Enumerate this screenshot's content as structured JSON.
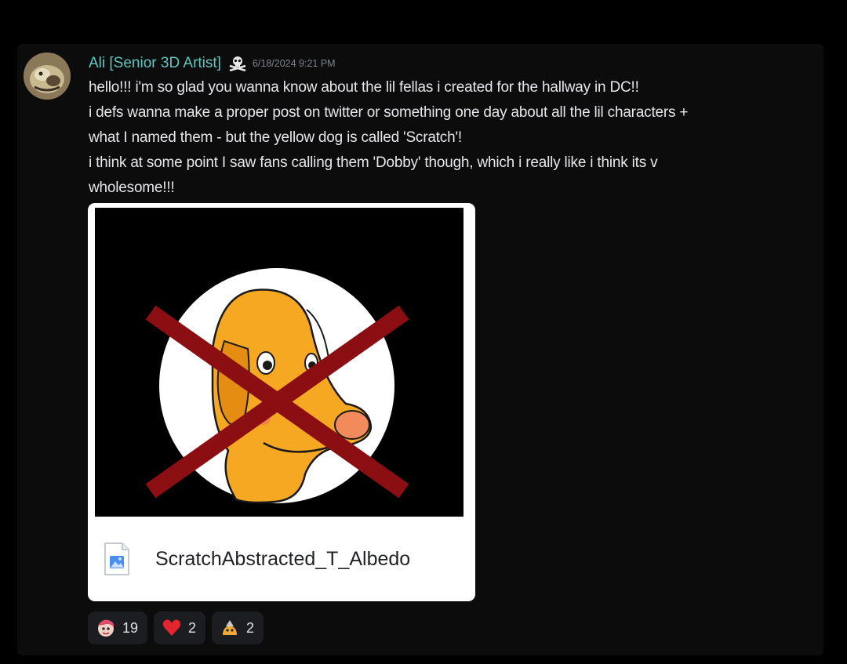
{
  "message": {
    "author": "Ali [Senior 3D Artist]",
    "role_icon": "skull-crossbones-icon",
    "timestamp": "6/18/2024 9:21 PM",
    "lines": [
      "hello!!! i'm so glad you wanna know about the lil fellas i created for the hallway in DC!!",
      "i defs wanna make a proper post on twitter or something one day about all the lil characters +",
      "what I named them - but the yellow dog is called 'Scratch'!",
      "i think at some point I saw fans calling them 'Dobby' though, which i really like i think its v",
      "wholesome!!!"
    ]
  },
  "attachment": {
    "file_name": "ScratchAbstracted_T_Albedo",
    "file_icon": "image-file-icon",
    "image_description_icon": "crossed-out-yellow-dog-icon"
  },
  "reactions": [
    {
      "emoji": "character-face-emoji",
      "count": "19"
    },
    {
      "emoji": "red-heart-emoji",
      "count": "2"
    },
    {
      "emoji": "little-creature-emoji",
      "count": "2"
    }
  ],
  "colors": {
    "username": "#5fc7bf",
    "text": "#e6e7ea",
    "timestamp": "#7f848c",
    "cross": "#8b0f12",
    "dog": "#f7a823"
  }
}
